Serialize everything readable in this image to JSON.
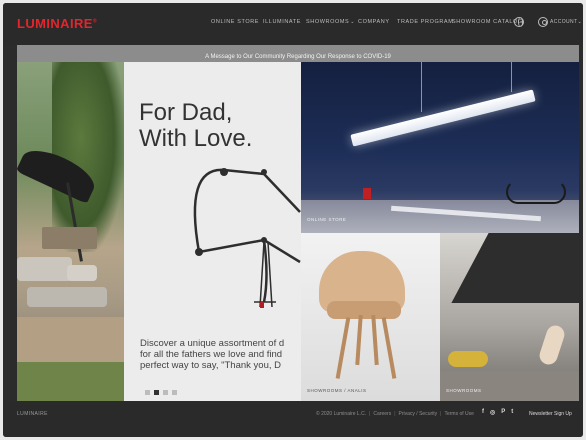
{
  "header": {
    "logo": "LUMINAIRE",
    "logo_mark": "®",
    "nav": [
      {
        "label": "ONLINE STORE",
        "has_dropdown": false
      },
      {
        "label": "ILLUMINATE",
        "has_dropdown": false
      },
      {
        "label": "SHOWROOMS",
        "has_dropdown": true
      },
      {
        "label": "COMPANY",
        "has_dropdown": false
      },
      {
        "label": "TRADE PROGRAM",
        "has_dropdown": false
      },
      {
        "label": "SHOWROOM CATALOG",
        "has_dropdown": false
      }
    ],
    "globe_icon": "globe-icon",
    "account_label": "ACCOUNT",
    "account_chevron": "⌄"
  },
  "banner": {
    "text": "A Message to Our Community Regarding Our Response to COVID-19"
  },
  "hero": {
    "title_lines": [
      "For Dad,",
      "With Love."
    ],
    "copy_lines": [
      "Discover a unique assortment of d",
      "for all the fathers we love and find",
      "perfect way to say, \"Thank you, D"
    ],
    "dots": 4,
    "active_dot": 1
  },
  "panels": {
    "online_store_label": "ONLINE STORE",
    "chair_label": "SHOWROOMS / ANALIS",
    "showrooms_label": "SHOWROOMS"
  },
  "footer": {
    "logo": "LUMINAIRE",
    "copyright": "© 2020 Luminaire L.C.",
    "links": [
      "Careers",
      "Privacy / Security",
      "Terms of Use"
    ],
    "social": [
      "f",
      "◎",
      "P",
      "t"
    ],
    "newsletter": "Newsletter Sign Up"
  },
  "colors": {
    "brand_red": "#e3252c",
    "header_bg": "#2a2a2a",
    "banner_bg": "#8c8c8c"
  }
}
